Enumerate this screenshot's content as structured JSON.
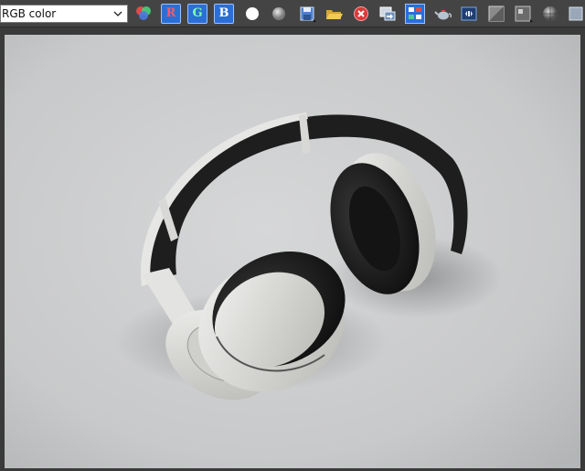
{
  "toolbar": {
    "channel_select": {
      "value": "RGB color"
    },
    "buttons": [
      {
        "name": "color-swatch-icon"
      },
      {
        "name": "red-channel-button",
        "label": "R"
      },
      {
        "name": "green-channel-button",
        "label": "G"
      },
      {
        "name": "blue-channel-button",
        "label": "B"
      },
      {
        "name": "white-background-icon"
      },
      {
        "name": "gray-background-icon"
      },
      {
        "name": "save-image-icon"
      },
      {
        "name": "open-folder-icon"
      },
      {
        "name": "clear-image-icon"
      },
      {
        "name": "copy-image-icon"
      },
      {
        "name": "clone-window-icon"
      },
      {
        "name": "render-teapot-icon"
      },
      {
        "name": "render-setup-icon"
      },
      {
        "name": "toggle-ui-icon"
      },
      {
        "name": "display-mode-icon"
      },
      {
        "name": "sphere-preview-icon"
      }
    ]
  },
  "colors": {
    "toolbar_bg": "#444444",
    "channel_button": "#2b6fd6",
    "viewport_bg": "#cfcfd0",
    "headphone_white": "#e6e6e4",
    "headphone_dark": "#1f1f1f"
  }
}
